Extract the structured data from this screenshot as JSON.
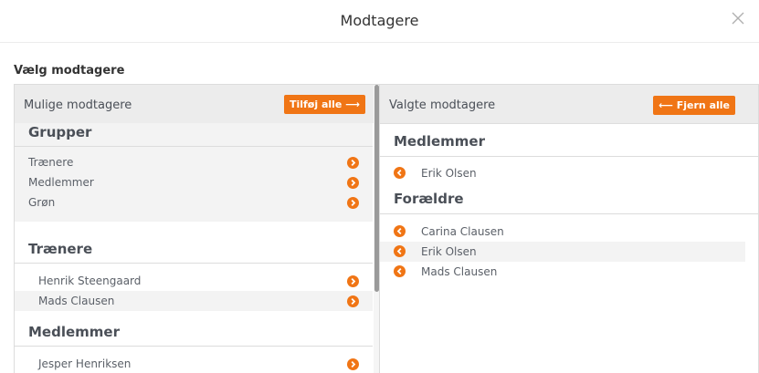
{
  "modal": {
    "title": "Modtagere"
  },
  "section_label": "Vælg modtagere",
  "left_pane": {
    "title": "Mulige modtagere",
    "add_all_label": "Tilføj alle",
    "groups": [
      {
        "title": "Grupper",
        "items": [
          "Trænere",
          "Medlemmer",
          "Grøn"
        ]
      },
      {
        "title": "Trænere",
        "items": [
          "Henrik Steengaard",
          "Mads Clausen"
        ]
      },
      {
        "title": "Medlemmer",
        "items": [
          "Jesper Henriksen"
        ]
      }
    ]
  },
  "right_pane": {
    "title": "Valgte modtagere",
    "remove_all_label": "Fjern alle",
    "groups": [
      {
        "title": "Medlemmer",
        "items": [
          "Erik Olsen"
        ]
      },
      {
        "title": "Forældre",
        "items": [
          "Carina Clausen",
          "Erik Olsen",
          "Mads Clausen"
        ]
      }
    ]
  },
  "icons": {
    "add": "chevron-right-icon",
    "remove": "chevron-left-icon",
    "close": "close-icon"
  },
  "colors": {
    "accent": "#f07515",
    "header_bg": "#ececec",
    "highlight_bg": "#f3f3f3"
  }
}
